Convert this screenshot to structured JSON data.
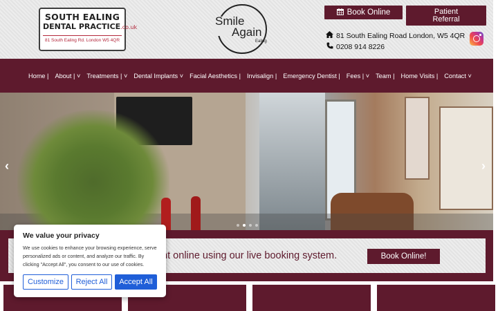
{
  "header": {
    "logo": {
      "line1": "SOUTH EALING",
      "line2": "DENTAL PRACTICE",
      "line2_suffix": ".co.uk",
      "line3": "81 South Ealing Rd. London W5 4QR"
    },
    "smile_logo": {
      "word1": "Smile",
      "word2": "Again",
      "word3": "Ealing"
    },
    "book_online": {
      "icon": "calendar-icon",
      "label": "Book Online"
    },
    "patient_referral": {
      "line1": "Patient",
      "line2": "Referral"
    },
    "address": {
      "icon": "home-icon",
      "text": "81 South Ealing Road London, W5 4QR"
    },
    "phone": {
      "icon": "phone-icon",
      "text": "0208 914 8226"
    },
    "instagram_icon": "instagram-icon"
  },
  "nav": {
    "items": [
      {
        "label": "Home |"
      },
      {
        "label": "About | ˅"
      },
      {
        "label": "Treatments | ˅"
      },
      {
        "label": "Dental Implants ˅"
      },
      {
        "label": "Facial Aesthetics |"
      },
      {
        "label": "Invisalign |"
      },
      {
        "label": "Emergency Dentist |"
      },
      {
        "label": "Fees | ˅"
      },
      {
        "label": "Team |"
      },
      {
        "label": "Home Visits |"
      },
      {
        "label": "Contact ˅"
      }
    ]
  },
  "hero": {
    "prev_arrow": "‹",
    "next_arrow": "›",
    "slide_count": 4,
    "active_slide": 2
  },
  "booking": {
    "text": "ent online using our live booking system.",
    "button": "Book Online!"
  },
  "cookie": {
    "title": "We value your privacy",
    "body": "We use cookies to enhance your browsing experience, serve personalized ads or content, and analyze our traffic. By clicking \"Accept All\", you consent to our use of cookies.",
    "customize": "Customize",
    "reject": "Reject All",
    "accept": "Accept All"
  },
  "colors": {
    "brand": "#5e1a2d",
    "accent_blue": "#1f5ed8"
  }
}
